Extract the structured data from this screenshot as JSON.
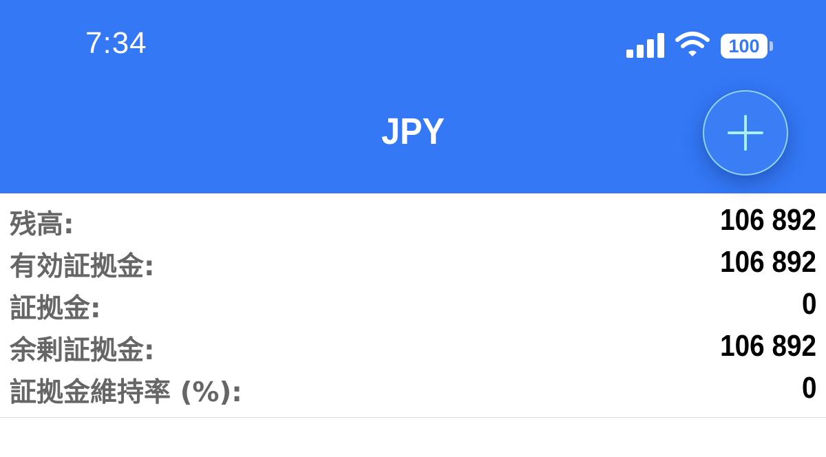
{
  "status_bar": {
    "time": "7:34",
    "battery": "100",
    "icons": [
      "signal-icon",
      "wifi-icon",
      "battery-icon"
    ]
  },
  "header": {
    "title": "JPY",
    "add_icon": "plus-icon",
    "background_color": "#3478f6"
  },
  "account": {
    "rows": [
      {
        "label": "残高:",
        "value": "106 892"
      },
      {
        "label": "有効証拠金:",
        "value": "106 892"
      },
      {
        "label": "証拠金:",
        "value": "0"
      },
      {
        "label": "余剰証拠金:",
        "value": "106 892"
      },
      {
        "label": "証拠金維持率 (%):",
        "value": "0"
      }
    ]
  }
}
